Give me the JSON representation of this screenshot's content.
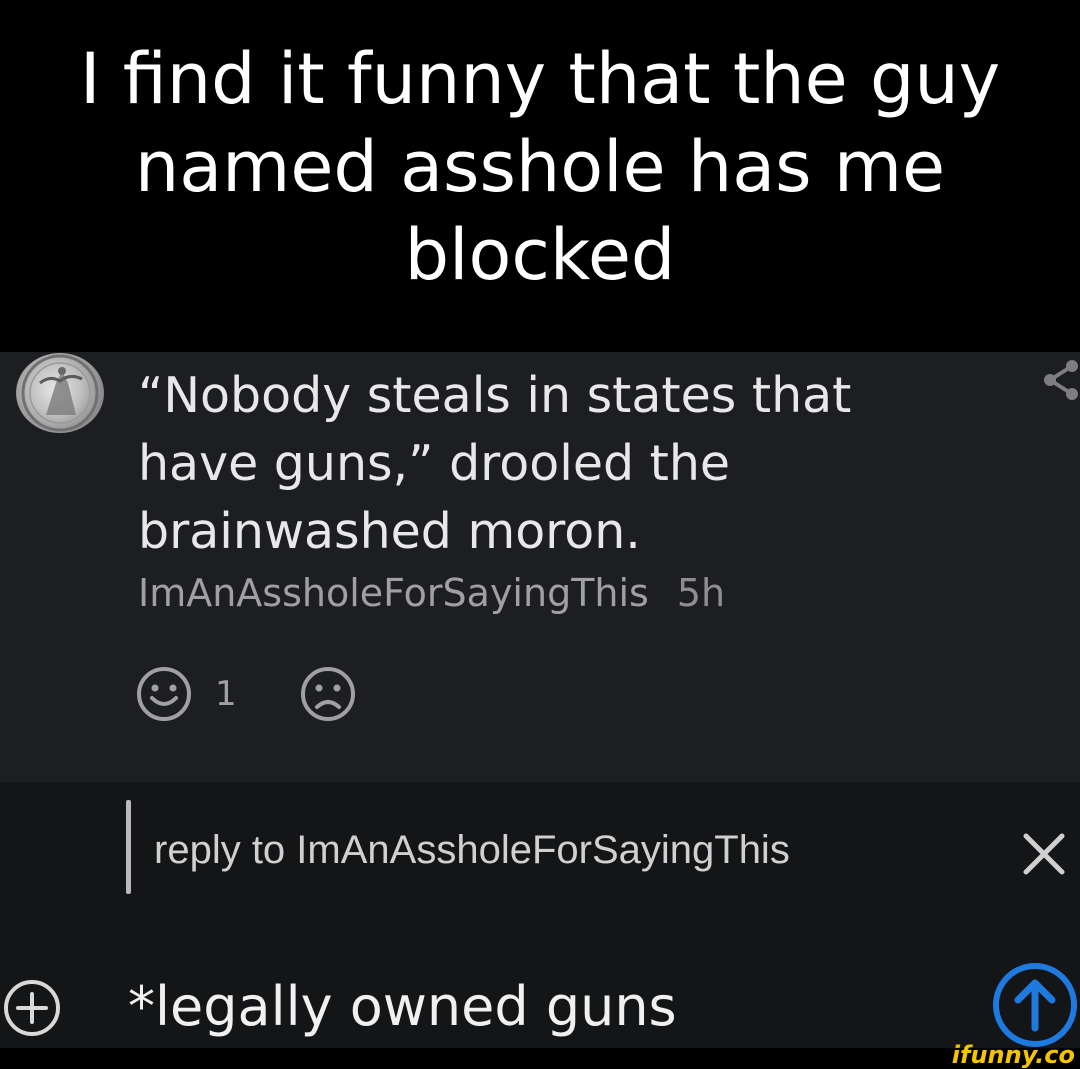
{
  "caption": {
    "text": "I find it funny that the guy named asshole has me blocked"
  },
  "comment": {
    "text": "“Nobody steals in states that have guns,” drooled the brainwashed moron.",
    "author": "ImAnAssholeForSayingThis",
    "time": "5h",
    "likes": "1",
    "icons": {
      "avatar": "silver-eagle-coin-avatar",
      "share": "share-icon",
      "like": "smile-face-icon",
      "dislike": "sad-face-icon"
    }
  },
  "reply": {
    "label": "reply to ImAnAssholeForSayingThis",
    "input_value": "*legally owned guns",
    "icons": {
      "close": "close-icon",
      "attach": "plus-circle-icon",
      "send": "arrow-up-circle-icon"
    },
    "send_color": "#1f7ae0"
  },
  "watermark": {
    "text": "ifunny.co"
  }
}
